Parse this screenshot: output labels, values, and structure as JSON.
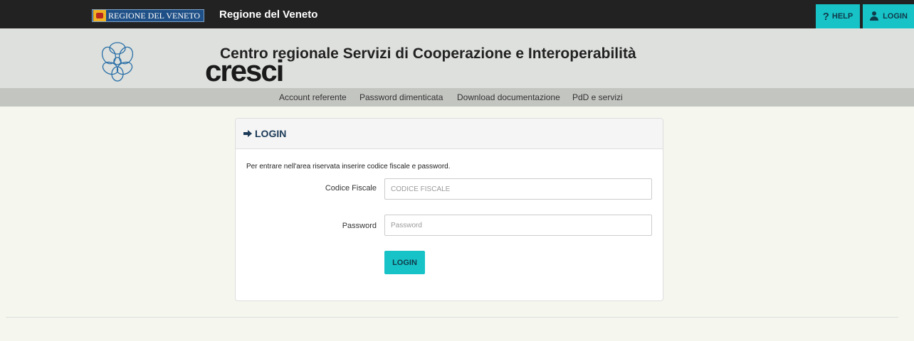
{
  "topbar": {
    "region_logo_text": "REGIONE DEL VENETO",
    "title": "Regione del Veneto",
    "help_label": "HELP",
    "login_label": "LOGIN"
  },
  "header": {
    "logo_text": "cresci",
    "title": "Centro regionale Servizi di Cooperazione e Interoperabilità"
  },
  "nav": {
    "items": [
      {
        "label": "Account referente"
      },
      {
        "label": "Password dimenticata"
      },
      {
        "label": "Download documentazione"
      },
      {
        "label": "PdD e servizi"
      }
    ]
  },
  "login_panel": {
    "title": "LOGIN",
    "intro": "Per entrare nell'area riservata inserire codice fiscale e password.",
    "codice_fiscale": {
      "label": "Codice Fiscale",
      "placeholder": "CODICE FISCALE",
      "value": ""
    },
    "password": {
      "label": "Password",
      "placeholder": "Password",
      "value": ""
    },
    "submit_label": "LOGIN"
  },
  "colors": {
    "accent": "#17c3c7",
    "topbar": "#222222",
    "header": "#dde0dc",
    "nav": "#c3c5c1"
  }
}
